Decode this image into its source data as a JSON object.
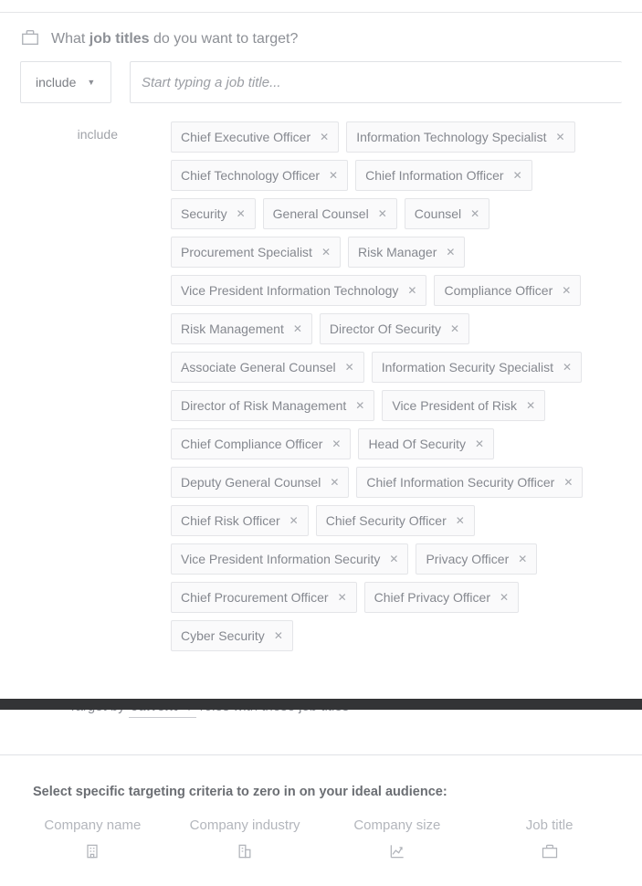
{
  "header": {
    "prefix": "What ",
    "bold": "job titles",
    "suffix": " do you want to target?"
  },
  "selector": {
    "include_label": "include",
    "input_placeholder": "Start typing a job title..."
  },
  "tag_group": {
    "label": "include",
    "tags": [
      "Chief Executive Officer",
      "Information Technology Specialist",
      "Chief Technology Officer",
      "Chief Information Officer",
      "Security",
      "General Counsel",
      "Counsel",
      "Procurement Specialist",
      "Risk Manager",
      "Vice President Information Technology",
      "Compliance Officer",
      "Risk Management",
      "Director Of Security",
      "Associate General Counsel",
      "Information Security Specialist",
      "Director of Risk Management",
      "Vice President of Risk",
      "Chief Compliance Officer",
      "Head Of Security",
      "Deputy General Counsel",
      "Chief Information Security Officer",
      "Chief Risk Officer",
      "Chief Security Officer",
      "Vice President Information Security",
      "Privacy Officer",
      "Chief Procurement Officer",
      "Chief Privacy Officer",
      "Cyber Security"
    ]
  },
  "target_by": {
    "prefix": "Target by ",
    "value": "current",
    "suffix": " roles with these job titles"
  },
  "criteria": {
    "title": "Select specific targeting criteria to zero in on your ideal audience:",
    "items": [
      {
        "label": "Company name",
        "icon": "building"
      },
      {
        "label": "Company industry",
        "icon": "industry"
      },
      {
        "label": "Company size",
        "icon": "chart"
      },
      {
        "label": "Job title",
        "icon": "briefcase"
      }
    ]
  }
}
